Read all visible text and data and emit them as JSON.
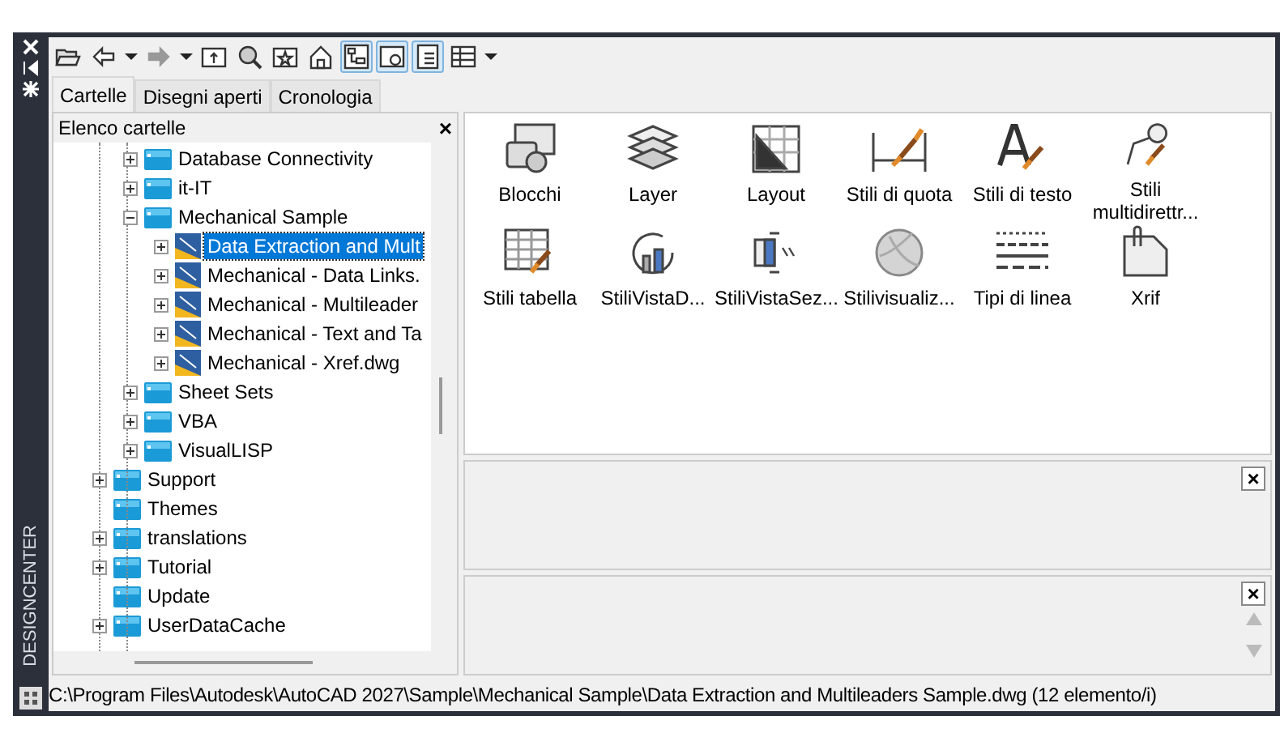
{
  "side_strip": {
    "title": "DESIGNCENTER"
  },
  "toolbar": [
    {
      "kind": "open",
      "on": false
    },
    {
      "kind": "back",
      "on": false
    },
    {
      "kind": "dropdown",
      "on": false
    },
    {
      "kind": "forward",
      "on": false
    },
    {
      "kind": "dropdown",
      "on": false
    },
    {
      "kind": "up",
      "on": false
    },
    {
      "kind": "search",
      "on": false
    },
    {
      "kind": "favorites",
      "on": false
    },
    {
      "kind": "home",
      "on": false
    },
    {
      "kind": "tree",
      "on": true
    },
    {
      "kind": "preview",
      "on": true
    },
    {
      "kind": "description",
      "on": true
    },
    {
      "kind": "views",
      "on": false
    },
    {
      "kind": "dropdown",
      "on": false
    }
  ],
  "tabs": [
    {
      "label": "Cartelle",
      "selected": true
    },
    {
      "label": "Disegni aperti",
      "selected": false
    },
    {
      "label": "Cronologia",
      "selected": false
    }
  ],
  "tree": {
    "title": "Elenco cartelle",
    "close": "×",
    "items": [
      {
        "children": [
          {
            "label": "Database Connectivity",
            "kind": "folder",
            "expandable": true,
            "expanded": false,
            "selected": false
          },
          {
            "label": "it-IT",
            "kind": "folder",
            "expandable": true,
            "expanded": false,
            "selected": false
          },
          {
            "label": "Mechanical Sample",
            "kind": "folder",
            "expandable": true,
            "expanded": true,
            "selected": false,
            "children": [
              {
                "label": "Data Extraction and Mult",
                "kind": "drawing",
                "expandable": true,
                "expanded": false,
                "selected": true
              },
              {
                "label": "Mechanical - Data Links.",
                "kind": "drawing",
                "expandable": true,
                "expanded": false,
                "selected": false
              },
              {
                "label": "Mechanical - Multileader",
                "kind": "drawing",
                "expandable": true,
                "expanded": false,
                "selected": false
              },
              {
                "label": "Mechanical - Text and Ta",
                "kind": "drawing",
                "expandable": true,
                "expanded": false,
                "selected": false
              },
              {
                "label": "Mechanical - Xref.dwg",
                "kind": "drawing",
                "expandable": true,
                "expanded": false,
                "selected": false
              }
            ]
          },
          {
            "label": "Sheet Sets",
            "kind": "folder",
            "expandable": true,
            "expanded": false,
            "selected": false
          },
          {
            "label": "VBA",
            "kind": "folder",
            "expandable": true,
            "expanded": false,
            "selected": false
          },
          {
            "label": "VisualLISP",
            "kind": "folder",
            "expandable": true,
            "expanded": false,
            "selected": false
          }
        ]
      },
      {
        "label": "Support",
        "kind": "folder",
        "expandable": true,
        "expanded": false,
        "selected": false
      },
      {
        "label": "Themes",
        "kind": "folder",
        "expandable": false,
        "selected": false
      },
      {
        "label": "translations",
        "kind": "folder",
        "expandable": true,
        "expanded": false,
        "selected": false
      },
      {
        "label": "Tutorial",
        "kind": "folder",
        "expandable": true,
        "expanded": false,
        "selected": false
      },
      {
        "label": "Update",
        "kind": "folder",
        "expandable": false,
        "selected": false
      },
      {
        "label": "UserDataCache",
        "kind": "folder",
        "expandable": true,
        "expanded": false,
        "selected": false
      }
    ]
  },
  "content": {
    "items": [
      {
        "label": "Blocchi",
        "kind": "blocks"
      },
      {
        "label": "Layer",
        "kind": "layers"
      },
      {
        "label": "Layout",
        "kind": "layout"
      },
      {
        "label": "Stili di quota",
        "kind": "dimstyle"
      },
      {
        "label": "Stili di testo",
        "kind": "textstyle"
      },
      {
        "label": "Stili multidirettr...",
        "kind": "mleader"
      },
      {
        "label": "Stili tabella",
        "kind": "tablestyle"
      },
      {
        "label": "StiliVistaD...",
        "kind": "detailview"
      },
      {
        "label": "StiliVistaSez...",
        "kind": "sectionview"
      },
      {
        "label": "Stilivisualiz...",
        "kind": "visualstyle"
      },
      {
        "label": "Tipi di linea",
        "kind": "linetype"
      },
      {
        "label": "Xrif",
        "kind": "xref"
      }
    ]
  },
  "preview": {
    "close": "×"
  },
  "description": {
    "close": "×"
  },
  "status_bar": "C:\\Program Files\\Autodesk\\AutoCAD 2027\\Sample\\Mechanical Sample\\Data Extraction and Multileaders Sample.dwg (12 elemento/i)"
}
